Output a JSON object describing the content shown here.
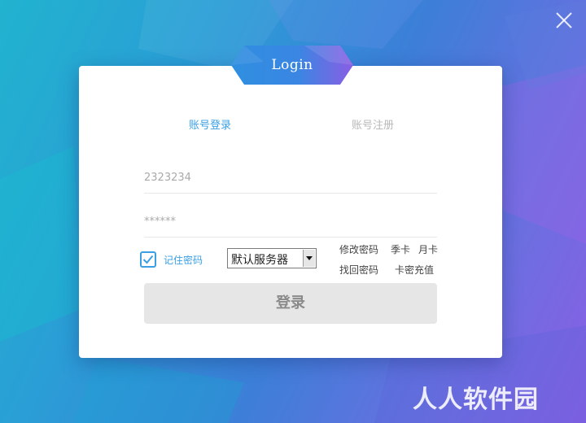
{
  "window": {
    "close_icon": "close-icon"
  },
  "header": {
    "badge_text": "Login"
  },
  "tabs": {
    "login": "账号登录",
    "register": "账号注册"
  },
  "form": {
    "username_value": "2323234",
    "password_value": "******",
    "remember_checked": true,
    "remember_label": "记住密码",
    "server_value": "默认服务器"
  },
  "links": {
    "change_password": "修改密码",
    "season_card": "季卡",
    "month_card": "月卡",
    "find_password": "找回密码",
    "card_recharge": "卡密充值"
  },
  "submit": {
    "label": "登录"
  },
  "watermark": {
    "text": "人人软件园"
  },
  "colors": {
    "accent": "#3ba0e3",
    "badge_left": "#2f8fe0",
    "badge_right": "#8a5ee4",
    "button_bg": "#e6e6e6"
  }
}
